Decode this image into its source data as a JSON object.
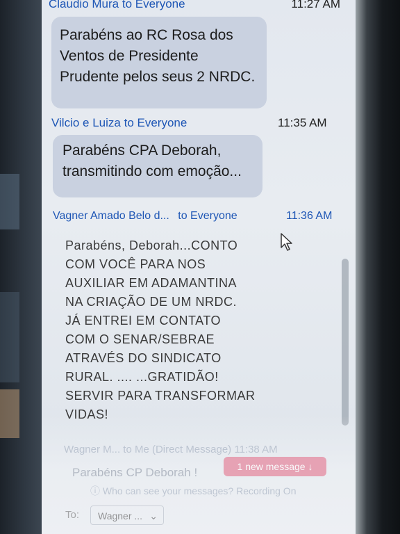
{
  "chat": {
    "messages": [
      {
        "sender": "Claudio Mura",
        "to": "to Everyone",
        "time": "11:27 AM",
        "text": [
          "Parabéns ao RC Rosa dos",
          "Ventos de Presidente",
          "Prudente pelos seus 2 NRDC."
        ]
      },
      {
        "sender": "Vilcio e Luiza",
        "to": "to Everyone",
        "time": "11:35 AM",
        "text": [
          "Parabéns CPA Deborah,",
          "transmitindo com emoção..."
        ]
      },
      {
        "sender": "Vagner Amado Belo d...",
        "to": "to Everyone",
        "time": "11:36 AM",
        "text": [
          "Parabéns, Deborah...CONTO",
          "COM VOCÊ PARA NOS",
          "AUXILIAR EM ADAMANTINA",
          "NA CRIAÇÃO DE UM NRDC.",
          "JÁ ENTREI EM CONTATO",
          "COM O SENAR/SEBRAE",
          "ATRAVÉS DO SINDICATO",
          "RURAL. .... ...GRATIDÃO!",
          "SERVIR PARA TRANSFORMAR",
          "VIDAS!"
        ]
      }
    ],
    "faded": {
      "sender_line": "Wagner M... to Me (Direct Message) 11:38 AM",
      "preview": "Parabéns CP Deborah !",
      "new_message_label": "1 new message",
      "privacy_note": "Who can see your messages? Recording On",
      "to_label": "To:",
      "to_value": "Wagner ..."
    }
  }
}
